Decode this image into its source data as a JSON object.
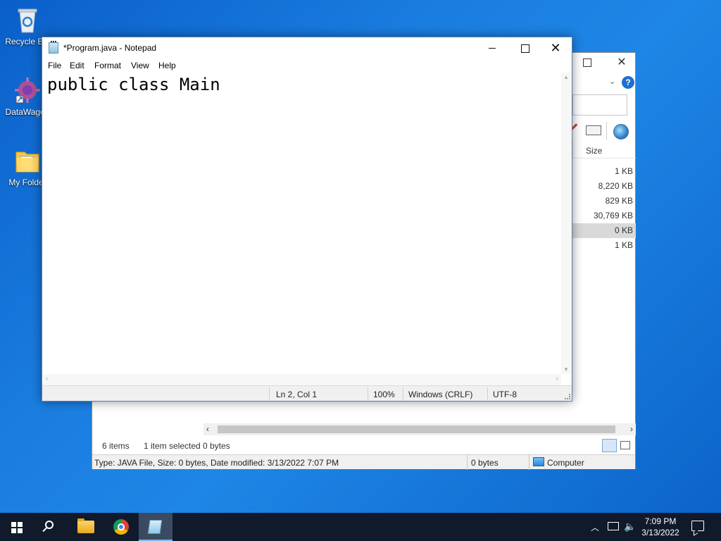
{
  "desktop": {
    "icons": [
      {
        "label": "Recycle Bin",
        "icon": "recycle-bin-icon"
      },
      {
        "label": "DataWagon",
        "icon": "datawagon-icon"
      },
      {
        "label": "My Folder",
        "icon": "folder-icon"
      }
    ]
  },
  "explorer": {
    "column_size": "Size",
    "sizes": [
      "1 KB",
      "8,220 KB",
      "829 KB",
      "30,769 KB",
      "0 KB",
      "1 KB"
    ],
    "selected_row": 4,
    "status": {
      "items": "6 items",
      "selected": "1 item selected",
      "selected_bytes": "0 bytes"
    },
    "details_bar": {
      "info": "Type: JAVA File, Size: 0 bytes, Date modified: 3/13/2022 7:07 PM",
      "bytes": "0 bytes",
      "location": "Computer"
    }
  },
  "notepad": {
    "title": "*Program.java - Notepad",
    "menu": [
      "File",
      "Edit",
      "Format",
      "View",
      "Help"
    ],
    "content": "public class Main",
    "status": {
      "position": "Ln 2, Col 1",
      "zoom": "100%",
      "line_endings": "Windows (CRLF)",
      "encoding": "UTF-8"
    }
  },
  "taskbar": {
    "time": "7:09 PM",
    "date": "3/13/2022",
    "pinned": [
      "start-icon",
      "search-icon",
      "file-explorer-icon",
      "chrome-icon",
      "notepad-icon"
    ]
  },
  "colors": {
    "desktop_blue": "#1a7de0",
    "taskbar": "#101a2b",
    "accent": "#76b9ed"
  }
}
